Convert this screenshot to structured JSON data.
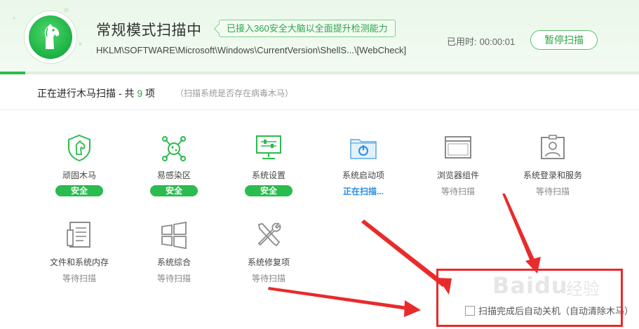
{
  "header": {
    "title": "常规模式扫描中",
    "badge": "已接入360安全大脑以全面提升检测能力",
    "scan_path": "HKLM\\SOFTWARE\\Microsoft\\Windows\\CurrentVersion\\ShellS...\\[WebCheck]",
    "elapsed_label": "已用时:",
    "elapsed_value": "00:00:01",
    "pause_button": "暂停扫描",
    "progress": 0.04
  },
  "subbar": {
    "prefix": "正在进行木马扫描 - 共 ",
    "count": "9",
    "suffix": " 项",
    "hint": "（扫描系统是否存在病毒木马）"
  },
  "items": [
    {
      "label": "顽固木马",
      "status": "安全",
      "state": "safe",
      "icon": "shield-horse-icon"
    },
    {
      "label": "易感染区",
      "status": "安全",
      "state": "safe",
      "icon": "virus-icon"
    },
    {
      "label": "系统设置",
      "status": "安全",
      "state": "safe",
      "icon": "monitor-settings-icon"
    },
    {
      "label": "系统启动项",
      "status": "正在扫描...",
      "state": "scanning",
      "icon": "startup-folder-icon"
    },
    {
      "label": "浏览器组件",
      "status": "等待扫描",
      "state": "waiting",
      "icon": "browser-window-icon"
    },
    {
      "label": "系统登录和服务",
      "status": "等待扫描",
      "state": "waiting",
      "icon": "user-badge-icon"
    },
    {
      "label": "文件和系统内存",
      "status": "等待扫描",
      "state": "waiting",
      "icon": "document-icon"
    },
    {
      "label": "系统综合",
      "status": "等待扫描",
      "state": "waiting",
      "icon": "windows-logo-icon"
    },
    {
      "label": "系统修复项",
      "status": "等待扫描",
      "state": "waiting",
      "icon": "repair-tools-icon"
    }
  ],
  "footer": {
    "checkbox_label": "扫描完成后自动关机（自动清除木马）",
    "checked": false
  },
  "watermark": {
    "text": "Baidu",
    "text2": "经验"
  },
  "colors": {
    "accent_green": "#2bbb4e",
    "scanning_blue": "#2a8ee0",
    "annotation_red": "#ea2a2a"
  }
}
